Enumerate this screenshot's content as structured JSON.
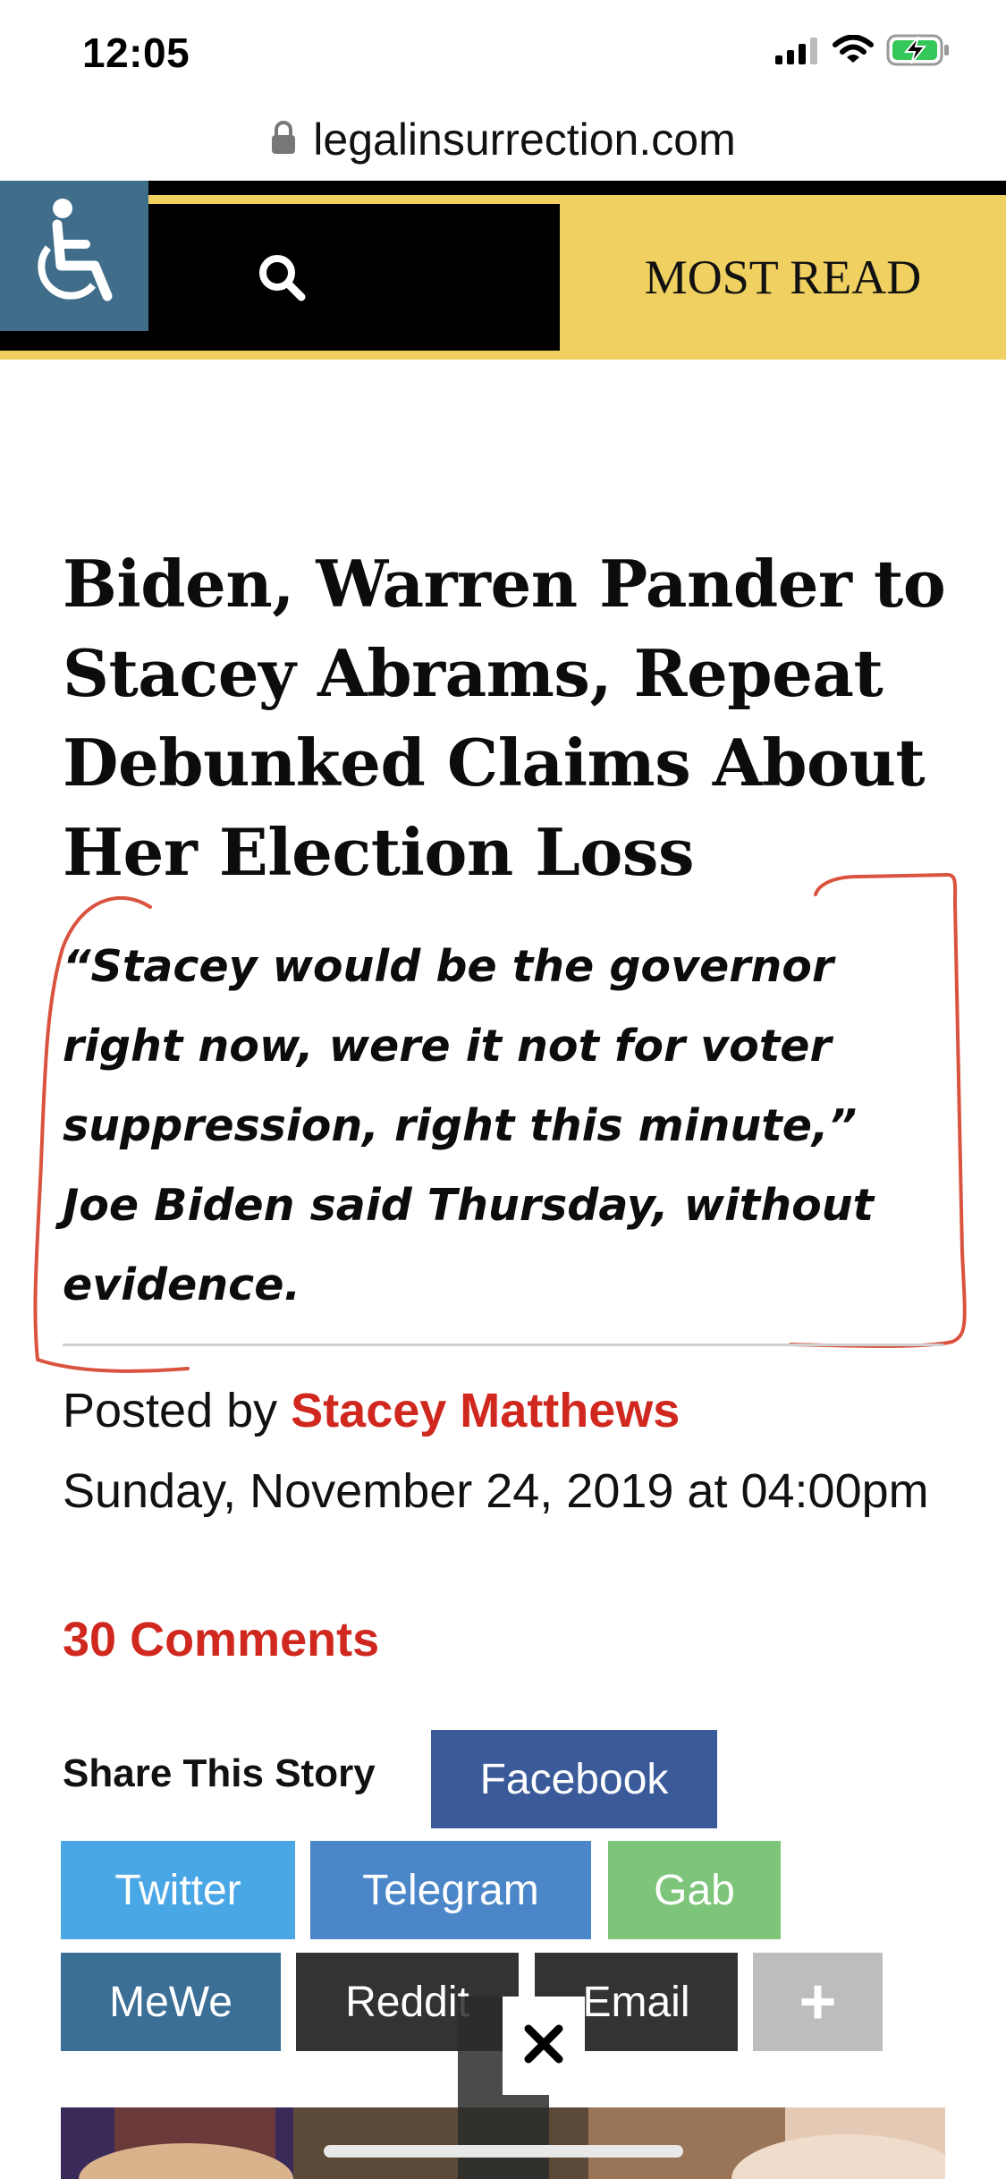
{
  "status_bar": {
    "time": "12:05"
  },
  "browser": {
    "url": "legalinsurrection.com"
  },
  "header": {
    "most_read_label": "MOST READ"
  },
  "article": {
    "title": "Biden, Warren Pander to Stacey Abrams, Repeat Debunked Claims About Her Election Loss",
    "lead_quote": "“Stacey would be the governor right now, were it not for voter suppression, right this minute,” Joe Biden said Thursday, without evidence.",
    "posted_by_prefix": "Posted by",
    "author": "Stacey Matthews",
    "date": "Sunday, November 24, 2019 at 04:00pm",
    "comments": "30 Comments"
  },
  "share": {
    "label": "Share This Story",
    "buttons": {
      "facebook": "Facebook",
      "twitter": "Twitter",
      "telegram": "Telegram",
      "gab": "Gab",
      "mewe": "MeWe",
      "reddit": "Reddit",
      "email": "Email",
      "more": "+"
    }
  },
  "colors": {
    "header_gold": "#f0d060",
    "accessibility_blue": "#3f6d8a",
    "accent_red": "#d0281e",
    "annotation_red": "#d9533f"
  },
  "icons": [
    "lock-icon",
    "signal-icon",
    "wifi-icon",
    "battery-charging-icon",
    "wheelchair-icon",
    "search-icon",
    "close-icon"
  ]
}
